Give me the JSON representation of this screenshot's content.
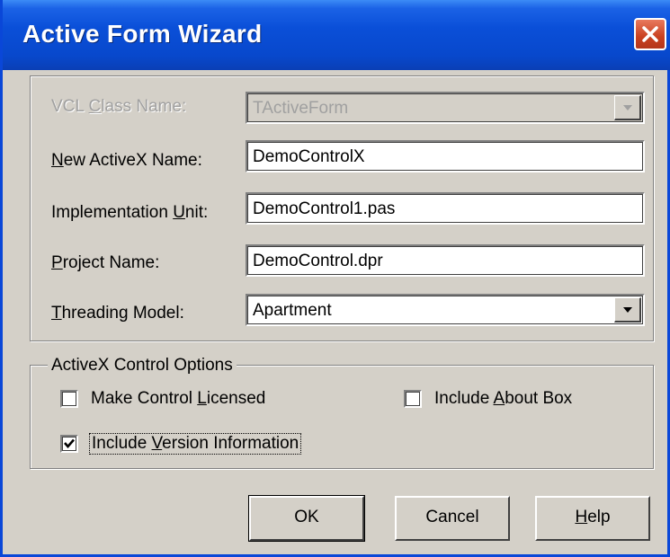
{
  "window": {
    "title": "Active Form Wizard"
  },
  "fields": {
    "vcl_class_name": {
      "label_pre": "VCL ",
      "label_acc": "C",
      "label_post": "lass Name:",
      "value": "TActiveForm"
    },
    "new_activex_name": {
      "label_pre": "",
      "label_acc": "N",
      "label_post": "ew ActiveX Name:",
      "value": "DemoControlX"
    },
    "implementation_unit": {
      "label_pre": "Implementation ",
      "label_acc": "U",
      "label_post": "nit:",
      "value": "DemoControl1.pas"
    },
    "project_name": {
      "label_pre": "",
      "label_acc": "P",
      "label_post": "roject Name:",
      "value": "DemoControl.dpr"
    },
    "threading_model": {
      "label_pre": "",
      "label_acc": "T",
      "label_post": "hreading Model:",
      "value": "Apartment"
    }
  },
  "options": {
    "title": "ActiveX Control Options",
    "make_licensed": {
      "pre": "Make Control ",
      "acc": "L",
      "post": "icensed",
      "checked": false
    },
    "include_about": {
      "pre": "Include ",
      "acc": "A",
      "post": "bout Box",
      "checked": false
    },
    "include_version": {
      "pre": "Include ",
      "acc": "V",
      "post": "ersion Information",
      "checked": true
    }
  },
  "buttons": {
    "ok": "OK",
    "cancel": "Cancel",
    "help_acc": "H",
    "help_post": "elp"
  },
  "colors": {
    "titlebar": "#0a4fd8",
    "face": "#d4d0c8",
    "close": "#c9401f"
  },
  "icons": {
    "close": "close-icon",
    "dropdown": "chevron-down-icon",
    "check": "checkmark-icon"
  }
}
